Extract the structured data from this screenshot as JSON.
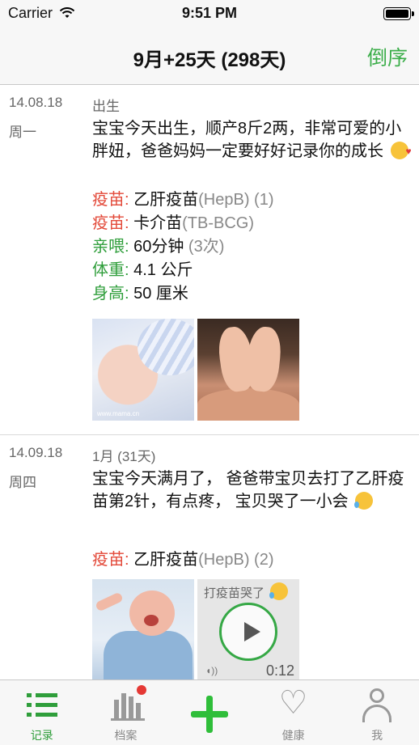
{
  "status_bar": {
    "carrier": "Carrier",
    "time": "9:51 PM"
  },
  "nav": {
    "title": "9月+25天 (298天)",
    "right_button": "倒序"
  },
  "entries": [
    {
      "date": "14.08.18",
      "weekday": "周一",
      "age": "出生",
      "text": "宝宝今天出生，顺产8斤2两，非常可爱的小胖妞，爸爸妈妈一定要好好记录你的成长",
      "facts": [
        {
          "key": "疫苗:",
          "value": " 乙肝疫苗",
          "extra": "(HepB) (1)"
        },
        {
          "key": "疫苗:",
          "value": " 卡介苗",
          "extra": "(TB-BCG)"
        },
        {
          "key": "亲喂:",
          "value": " 60分钟 ",
          "extra": "(3次)"
        },
        {
          "key": "体重:",
          "value": " 4.1 公斤",
          "extra": ""
        },
        {
          "key": "身高:",
          "value": " 50 厘米",
          "extra": ""
        }
      ],
      "photos": [
        "newborn-photo",
        "feet-photo"
      ]
    },
    {
      "date": "14.09.18",
      "weekday": "周四",
      "age": "1月 (31天)",
      "text": "宝宝今天满月了， 爸爸带宝贝去打了乙肝疫苗第2针，有点疼， 宝贝哭了一小会",
      "facts": [
        {
          "key": "疫苗:",
          "value": " 乙肝疫苗",
          "extra": "(HepB) (2)"
        }
      ],
      "voice": {
        "label": "打疫苗哭了",
        "duration": "0:12"
      }
    }
  ],
  "tabs": [
    {
      "label": "记录",
      "icon": "list-icon",
      "active": true
    },
    {
      "label": "档案",
      "icon": "chart-icon",
      "badge": true
    },
    {
      "label": "",
      "icon": "plus-icon"
    },
    {
      "label": "健康",
      "icon": "heart-icon"
    },
    {
      "label": "我",
      "icon": "person-icon"
    }
  ],
  "colors": {
    "accent_green": "#2f9e3b",
    "vaccine_red": "#e34a3a",
    "badge_red": "#e53935"
  }
}
